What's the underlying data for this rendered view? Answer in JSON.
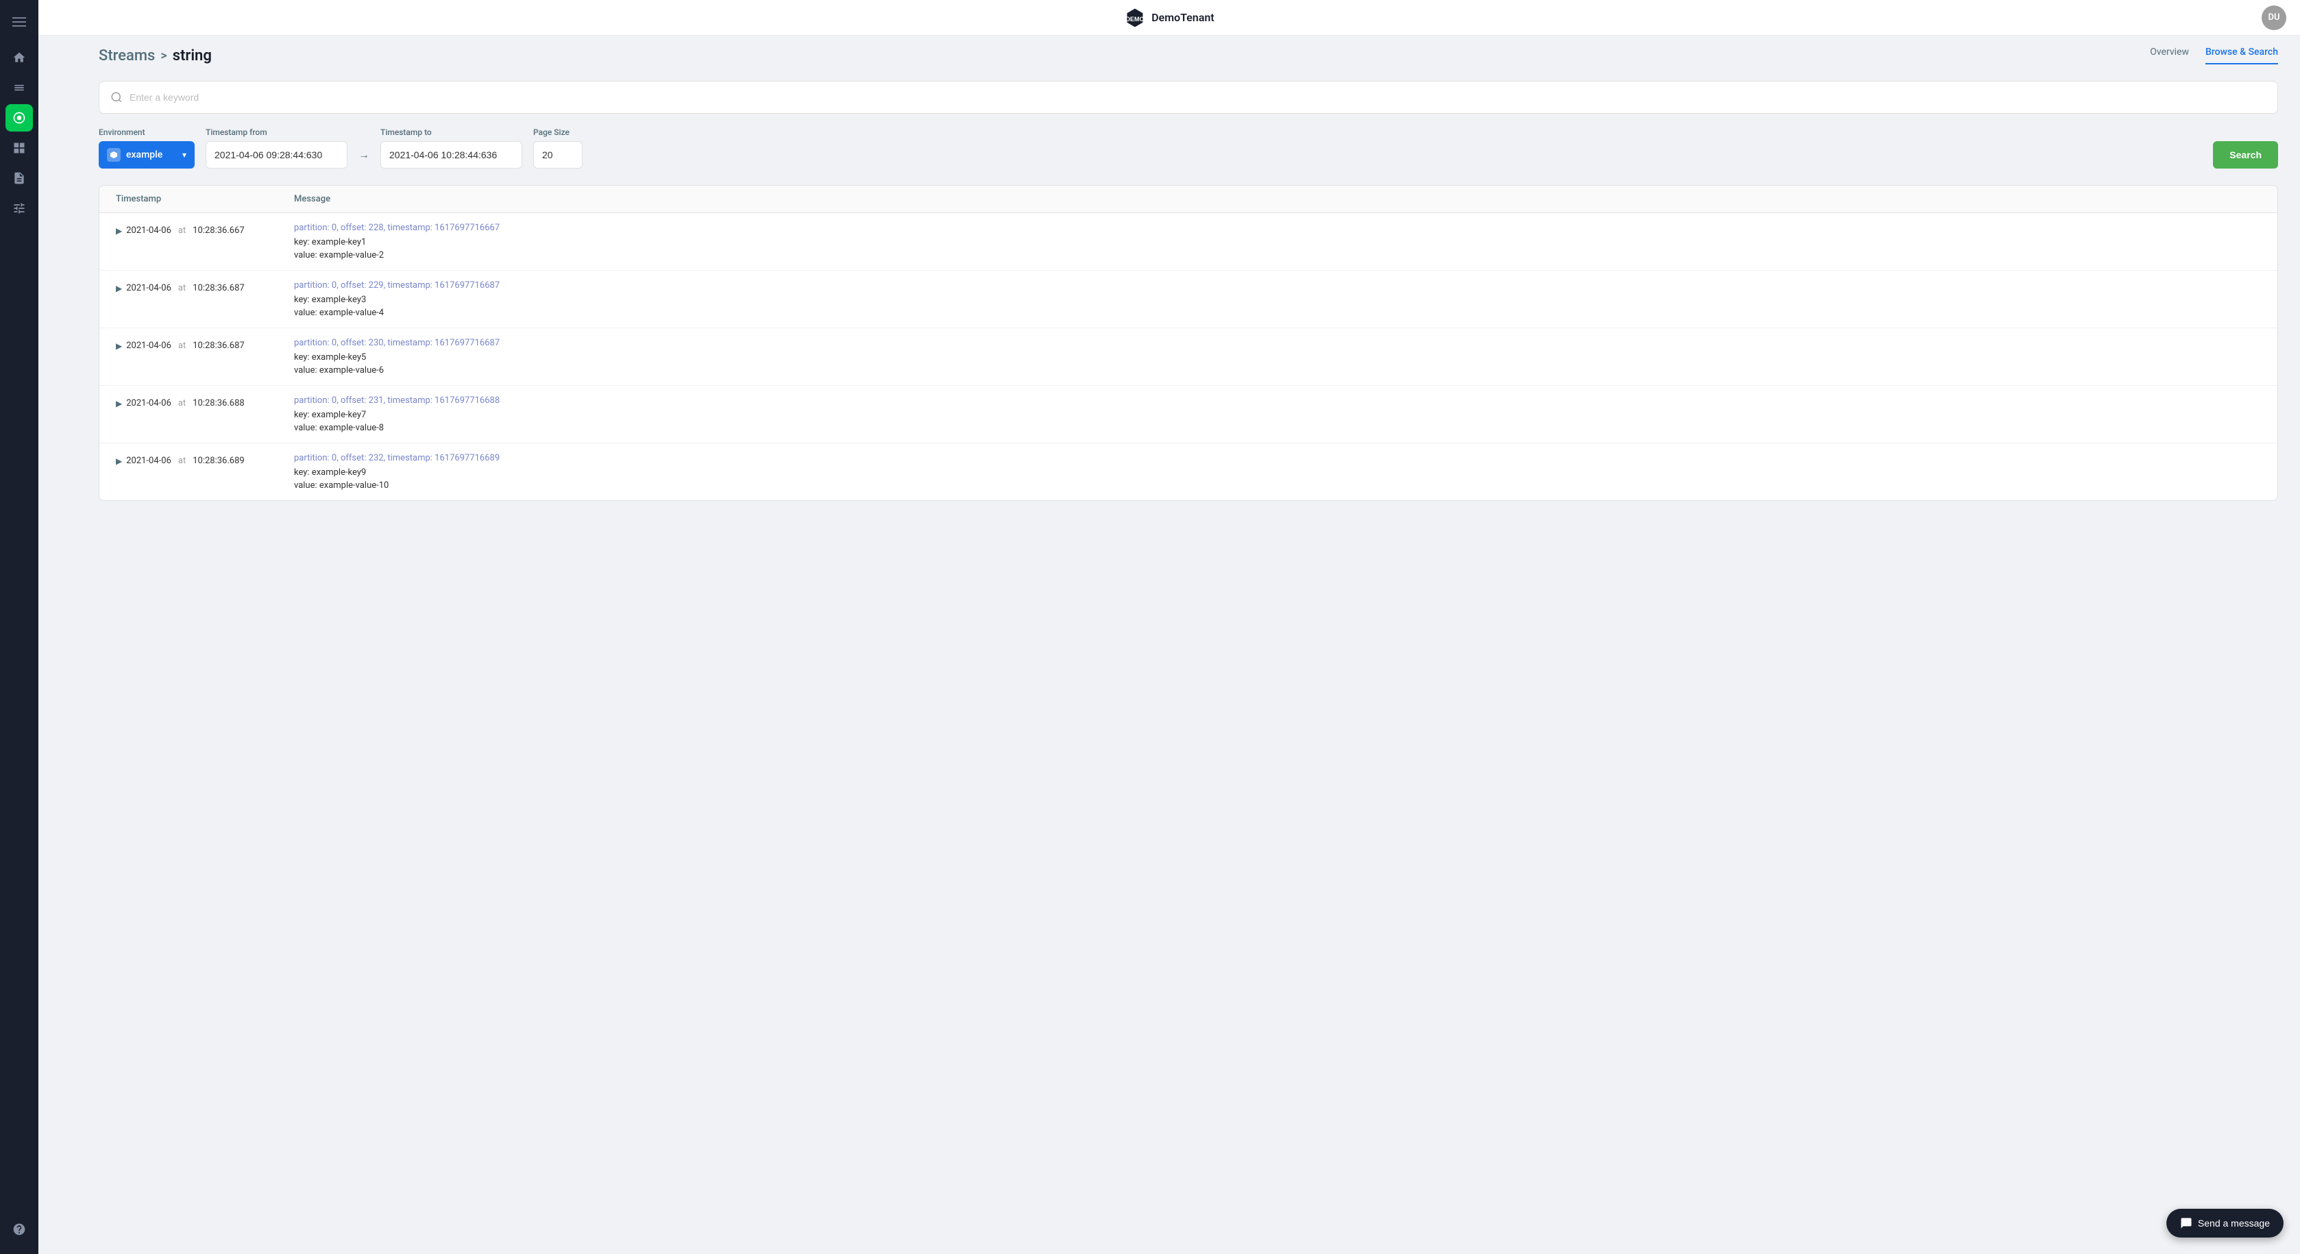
{
  "app": {
    "name": "DemoTenant",
    "topbar_avatar": "DU"
  },
  "sidebar": {
    "icons": [
      {
        "name": "menu-icon",
        "symbol": "☰"
      },
      {
        "name": "home-icon",
        "symbol": "⌂"
      },
      {
        "name": "streams-icon",
        "symbol": "⇄"
      },
      {
        "name": "topics-icon",
        "symbol": "◎"
      },
      {
        "name": "dashboard-icon",
        "symbol": "▦"
      },
      {
        "name": "documents-icon",
        "symbol": "▤"
      },
      {
        "name": "settings-icon",
        "symbol": "⚙"
      },
      {
        "name": "help-icon",
        "symbol": "?"
      }
    ]
  },
  "breadcrumb": {
    "parent": "Streams",
    "separator": ">",
    "current": "string"
  },
  "tabs": [
    {
      "label": "Overview",
      "active": false
    },
    {
      "label": "Browse & Search",
      "active": true
    }
  ],
  "search": {
    "placeholder": "Enter a keyword"
  },
  "filters": {
    "environment_label": "Environment",
    "environment_value": "example",
    "timestamp_from_label": "Timestamp from",
    "timestamp_from_value": "2021-04-06 09:28:44:630",
    "timestamp_to_label": "Timestamp to",
    "timestamp_to_value": "2021-04-06 10:28:44:636",
    "page_size_label": "Page Size",
    "page_size_value": "20",
    "search_button": "Search"
  },
  "table": {
    "columns": [
      "Timestamp",
      "Message"
    ],
    "rows": [
      {
        "date": "2021-04-06",
        "at": "at",
        "time": "10:28:36.667",
        "meta": "partition: 0, offset: 228, timestamp: 1617697716667",
        "key": "key: example-key1",
        "value": "value: example-value-2"
      },
      {
        "date": "2021-04-06",
        "at": "at",
        "time": "10:28:36.687",
        "meta": "partition: 0, offset: 229, timestamp: 1617697716687",
        "key": "key: example-key3",
        "value": "value: example-value-4"
      },
      {
        "date": "2021-04-06",
        "at": "at",
        "time": "10:28:36.687",
        "meta": "partition: 0, offset: 230, timestamp: 1617697716687",
        "key": "key: example-key5",
        "value": "value: example-value-6"
      },
      {
        "date": "2021-04-06",
        "at": "at",
        "time": "10:28:36.688",
        "meta": "partition: 0, offset: 231, timestamp: 1617697716688",
        "key": "key: example-key7",
        "value": "value: example-value-8"
      },
      {
        "date": "2021-04-06",
        "at": "at",
        "time": "10:28:36.689",
        "meta": "partition: 0, offset: 232, timestamp: 1617697716689",
        "key": "key: example-key9",
        "value": "value: example-value-10"
      }
    ]
  },
  "chat": {
    "button_label": "Send a message"
  }
}
